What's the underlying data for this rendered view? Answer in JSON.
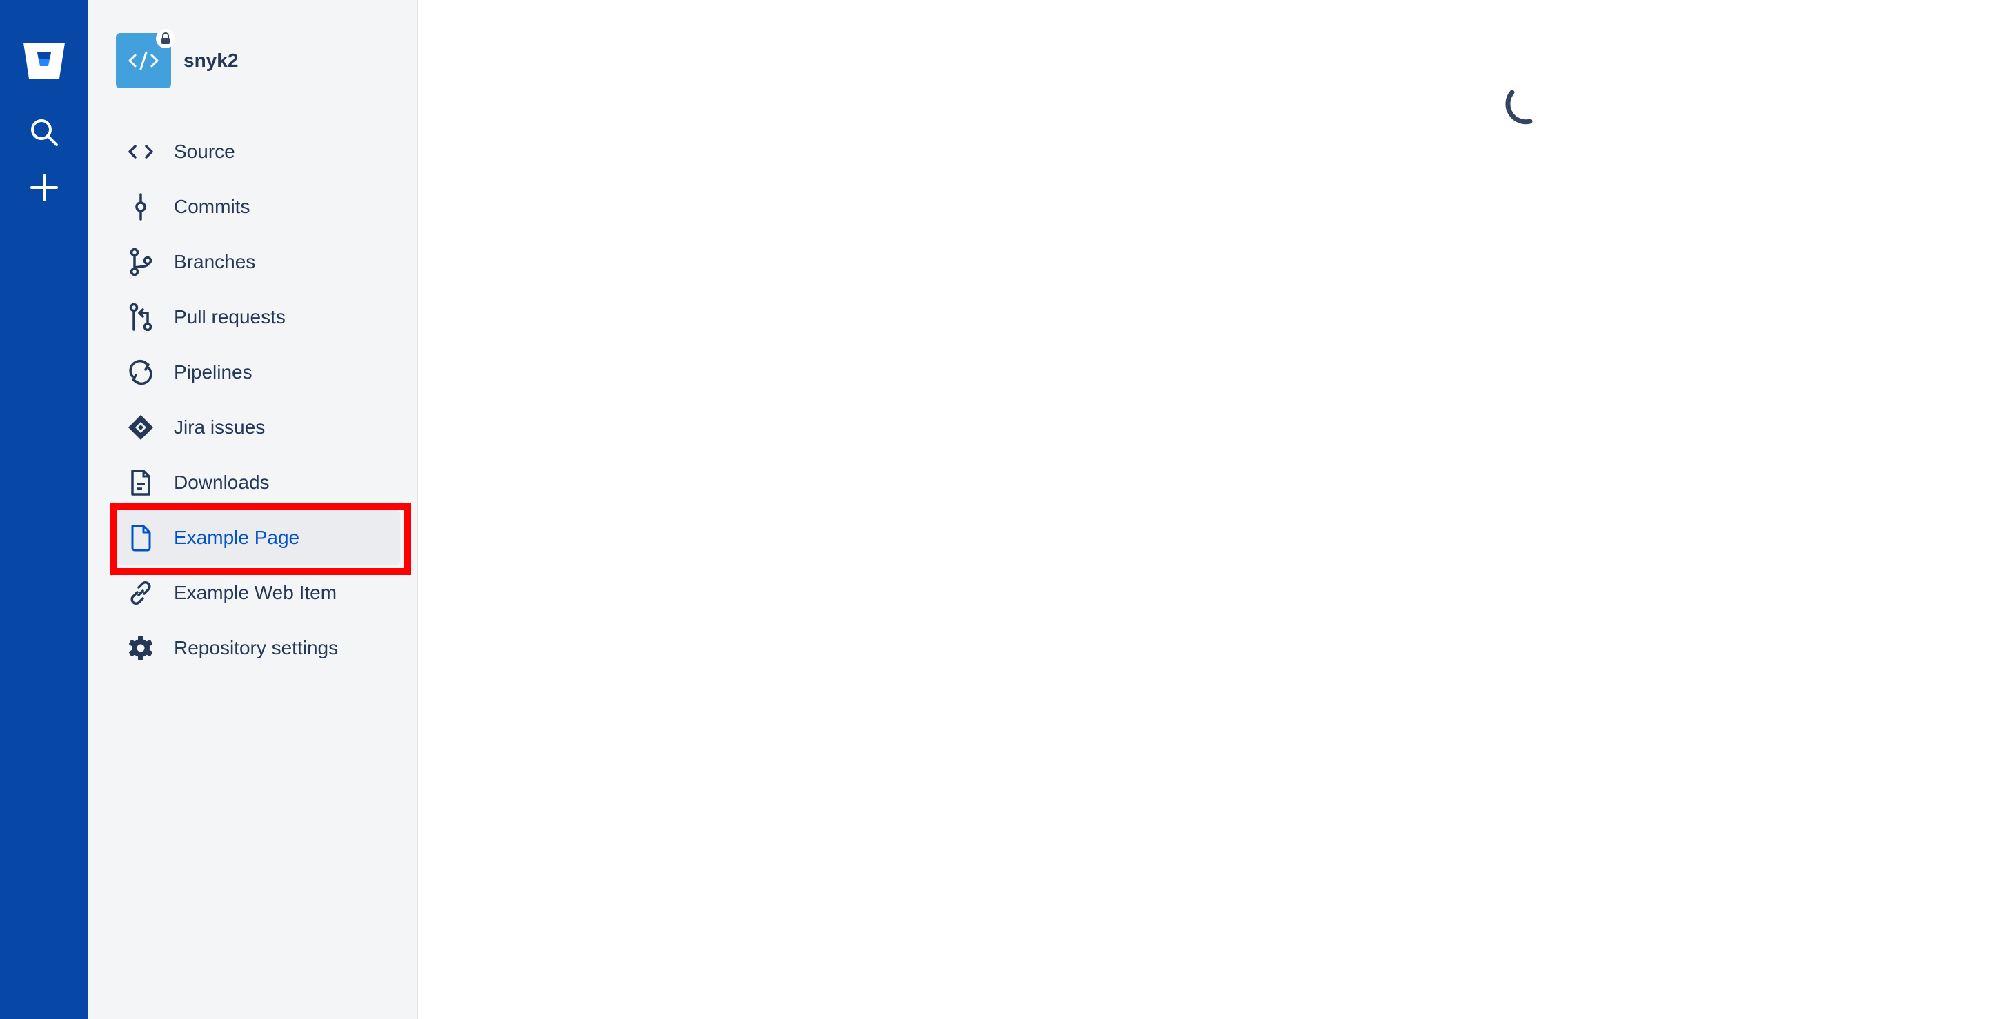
{
  "global_nav": {
    "logo_icon": "bitbucket-logo-icon",
    "items": [
      {
        "icon": "search-icon"
      },
      {
        "icon": "plus-icon"
      }
    ],
    "background": "#0747a6"
  },
  "repository": {
    "name": "snyk2",
    "avatar_icon": "code-icon",
    "private_icon": "lock-icon",
    "avatar_color": "#42a0dc"
  },
  "sidebar": {
    "items": [
      {
        "label": "Source",
        "icon": "source-code-icon"
      },
      {
        "label": "Commits",
        "icon": "commit-icon"
      },
      {
        "label": "Branches",
        "icon": "branch-icon"
      },
      {
        "label": "Pull requests",
        "icon": "pull-request-icon"
      },
      {
        "label": "Pipelines",
        "icon": "pipelines-icon"
      },
      {
        "label": "Jira issues",
        "icon": "jira-icon"
      },
      {
        "label": "Downloads",
        "icon": "download-document-icon"
      },
      {
        "label": "Example Page",
        "icon": "page-icon",
        "selected": true
      },
      {
        "label": "Example Web Item",
        "icon": "link-icon"
      },
      {
        "label": "Repository settings",
        "icon": "gear-icon"
      }
    ],
    "selected_color": "#0052cc",
    "highlight_color": "#ff0000"
  },
  "main": {
    "loading_icon": "spinner-icon"
  }
}
